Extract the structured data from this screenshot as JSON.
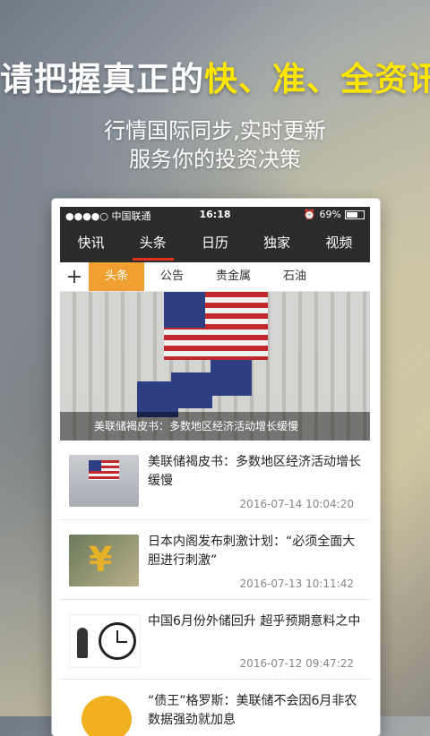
{
  "promo": {
    "headline_prefix": "请把握真正的",
    "headline_highlight": "快、准、全资讯",
    "subtitle_line1": "行情国际同步,实时更新",
    "subtitle_line2": "服务你的投资决策"
  },
  "status_bar": {
    "carrier": "●●●●○ 中国联通",
    "time": "16:18",
    "battery": "69%"
  },
  "nav_tabs": [
    "快讯",
    "头条",
    "日历",
    "独家",
    "视频"
  ],
  "sub_tabs": [
    "头条",
    "公告",
    "贵金属",
    "石油"
  ],
  "hero_caption": "美联储褐皮书：多数地区经济活动增长缓慢",
  "news": [
    {
      "title": "美联储褐皮书：多数地区经济活动增长缓慢",
      "date": "2016-07-14 10:04:20"
    },
    {
      "title": "日本内阁发布刺激计划：“必须全面大胆进行刺激”",
      "date": "2016-07-13 10:11:42"
    },
    {
      "title": "中国6月份外储回升 超乎预期意料之中",
      "date": "2016-07-12 09:47:22"
    },
    {
      "title": "“债王”格罗斯：美联储不会因6月非农数据强劲就加息",
      "date": ""
    }
  ],
  "colors": {
    "highlight": "#ffe600",
    "navbar_bg": "#2b2b2b",
    "active_underline": "#e0301e",
    "subtab_active": "#f0a030"
  }
}
